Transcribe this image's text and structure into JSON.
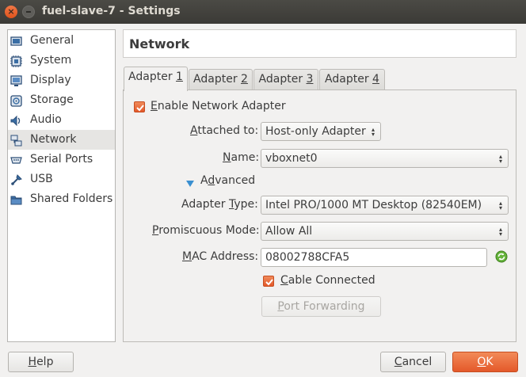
{
  "window": {
    "title": "fuel-slave-7 - Settings"
  },
  "sidebar": {
    "items": [
      {
        "label": "General",
        "icon": "general-icon"
      },
      {
        "label": "System",
        "icon": "system-icon"
      },
      {
        "label": "Display",
        "icon": "display-icon"
      },
      {
        "label": "Storage",
        "icon": "storage-icon"
      },
      {
        "label": "Audio",
        "icon": "audio-icon"
      },
      {
        "label": "Network",
        "icon": "network-icon",
        "selected": true
      },
      {
        "label": "Serial Ports",
        "icon": "serial-ports-icon"
      },
      {
        "label": "USB",
        "icon": "usb-icon"
      },
      {
        "label": "Shared Folders",
        "icon": "shared-folders-icon"
      }
    ]
  },
  "header": {
    "title": "Network"
  },
  "tabs": [
    {
      "label": "Adapter ",
      "mnemonic": "1",
      "active": true
    },
    {
      "label": "Adapter ",
      "mnemonic": "2"
    },
    {
      "label": "Adapter ",
      "mnemonic": "3"
    },
    {
      "label": "Adapter ",
      "mnemonic": "4"
    }
  ],
  "form": {
    "enable_adapter": {
      "mnemonic": "E",
      "rest": "nable Network Adapter",
      "checked": true
    },
    "attached_to": {
      "label_mn": "A",
      "label_rest": "ttached to:",
      "value": "Host-only Adapter"
    },
    "name": {
      "label_mn": "N",
      "label_rest": "ame:",
      "value": "vboxnet0"
    },
    "advanced": {
      "label_mn": "d",
      "label_pre": "A",
      "label_rest": "vanced"
    },
    "adapter_type": {
      "label_pre": "Adapter ",
      "label_mn": "T",
      "label_rest": "ype:",
      "value": "Intel PRO/1000 MT Desktop (82540EM)"
    },
    "promiscuous": {
      "label_mn": "P",
      "label_rest": "romiscuous Mode:",
      "value": "Allow All"
    },
    "mac": {
      "label_mn": "M",
      "label_rest": "AC Address:",
      "value": "08002788CFA5"
    },
    "cable": {
      "label_mn": "C",
      "label_rest": "able Connected",
      "checked": true
    },
    "port_forwarding": {
      "label_mn": "P",
      "label_rest": "ort Forwarding"
    }
  },
  "footer": {
    "help": {
      "mn": "H",
      "rest": "elp"
    },
    "cancel": {
      "mn": "C",
      "rest": "ancel"
    },
    "ok": {
      "mn": "O",
      "rest": "K"
    }
  },
  "colors": {
    "accent": "#e4592a",
    "selected_bg": "#e6e5e3"
  }
}
